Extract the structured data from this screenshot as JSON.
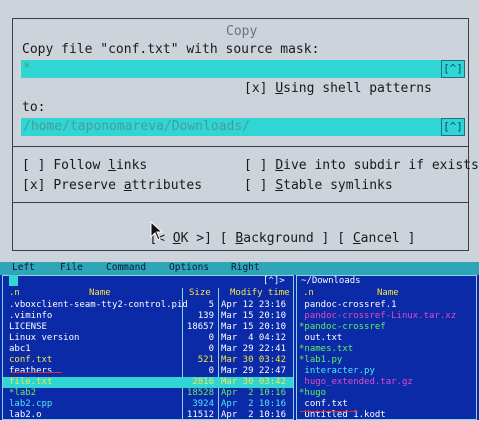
{
  "dialog": {
    "title": "Copy",
    "prompt": "Copy file \"conf.txt\" with source mask:",
    "source_mask": "*",
    "history_button": "[^]",
    "shell_patterns": {
      "mark": "[x] ",
      "pre": "",
      "hot": "U",
      "post": "sing shell patterns"
    },
    "to_label": "to:",
    "destination": "/home/taponomareva/Downloads/",
    "follow_links": {
      "mark": "[ ] ",
      "pre": "Follow ",
      "hot": "l",
      "post": "inks"
    },
    "preserve_attrs": {
      "mark": "[x] ",
      "pre": "Preserve ",
      "hot": "a",
      "post": "ttributes"
    },
    "dive_subdir": {
      "mark": "[ ] ",
      "pre": "",
      "hot": "D",
      "post": "ive into subdir if exists"
    },
    "stable_symlinks": {
      "mark": "[ ] ",
      "pre": "",
      "hot": "S",
      "post": "table symlinks"
    },
    "ok_button": {
      "open": "[< ",
      "hot": "O",
      "post": "K",
      "close": " >]"
    },
    "background_button": {
      "open": "[ ",
      "hot": "B",
      "post": "ackground",
      "close": " ]"
    },
    "cancel_button": {
      "open": "[ ",
      "hot": "C",
      "post": "ancel",
      "close": " ]"
    }
  },
  "menu": [
    "Left",
    "File",
    "Command",
    "Options",
    "Right"
  ],
  "left_panel": {
    "top_right": "[^]>",
    "headers": {
      "n": ".n",
      "name": "Name",
      "size": "Size",
      "mtime": "Modify time"
    },
    "rows": [
      {
        "name": ".vboxclient-seam-tty2-control.pid",
        "size": "5",
        "time": "Apr 12 23:16",
        "color": "c-white"
      },
      {
        "name": ".viminfo",
        "size": "139",
        "time": "Mar 15 20:10",
        "color": "c-white"
      },
      {
        "name": "LICENSE",
        "size": "18657",
        "time": "Mar 15 20:10",
        "color": "c-white"
      },
      {
        "name": "Linux version",
        "size": "0",
        "time": "Mar  4 04:12",
        "color": "c-white"
      },
      {
        "name": "abc1",
        "size": "0",
        "time": "Mar 29 22:41",
        "color": "c-white"
      },
      {
        "name": "conf.txt",
        "size": "521",
        "time": "Mar 30 03:42",
        "color": "c-yellow"
      },
      {
        "name": "feathers",
        "size": "0",
        "time": "Mar 29 22:47",
        "color": "c-white"
      },
      {
        "name": "file.txt",
        "size": "2816",
        "time": "Mar 30 03:42",
        "color": "c-white",
        "selected": true
      },
      {
        "name": "*lab2",
        "size": "18528",
        "time": "Apr  2 10:16",
        "color": "c-green"
      },
      {
        "name": "lab2.cpp",
        "size": "3924",
        "time": "Apr  2 10:16",
        "color": "c-cyan"
      },
      {
        "name": "lab2.o",
        "size": "11512",
        "time": "Apr  2 10:16",
        "color": "c-white"
      }
    ]
  },
  "right_panel": {
    "path": "~/Downloads",
    "headers": {
      "n": ".n",
      "name": "Name"
    },
    "rows": [
      {
        "name": " pandoc-crossref.1",
        "color": "c-white"
      },
      {
        "name": " pandoc-crossref-Linux.tar.xz",
        "color": "c-magenta"
      },
      {
        "name": "*pandoc-crossref",
        "color": "c-green"
      },
      {
        "name": " out.txt",
        "color": "c-white"
      },
      {
        "name": "*names.txt",
        "color": "c-green"
      },
      {
        "name": "*lab1.py",
        "color": "c-green"
      },
      {
        "name": " interacter.py",
        "color": "c-cyan"
      },
      {
        "name": " hugo_extended.tar.gz",
        "color": "c-magenta"
      },
      {
        "name": "*hugo",
        "color": "c-green"
      },
      {
        "name": " conf.txt",
        "color": "c-white"
      },
      {
        "name": " Untitled 1.kodt",
        "color": "c-white"
      }
    ]
  }
}
